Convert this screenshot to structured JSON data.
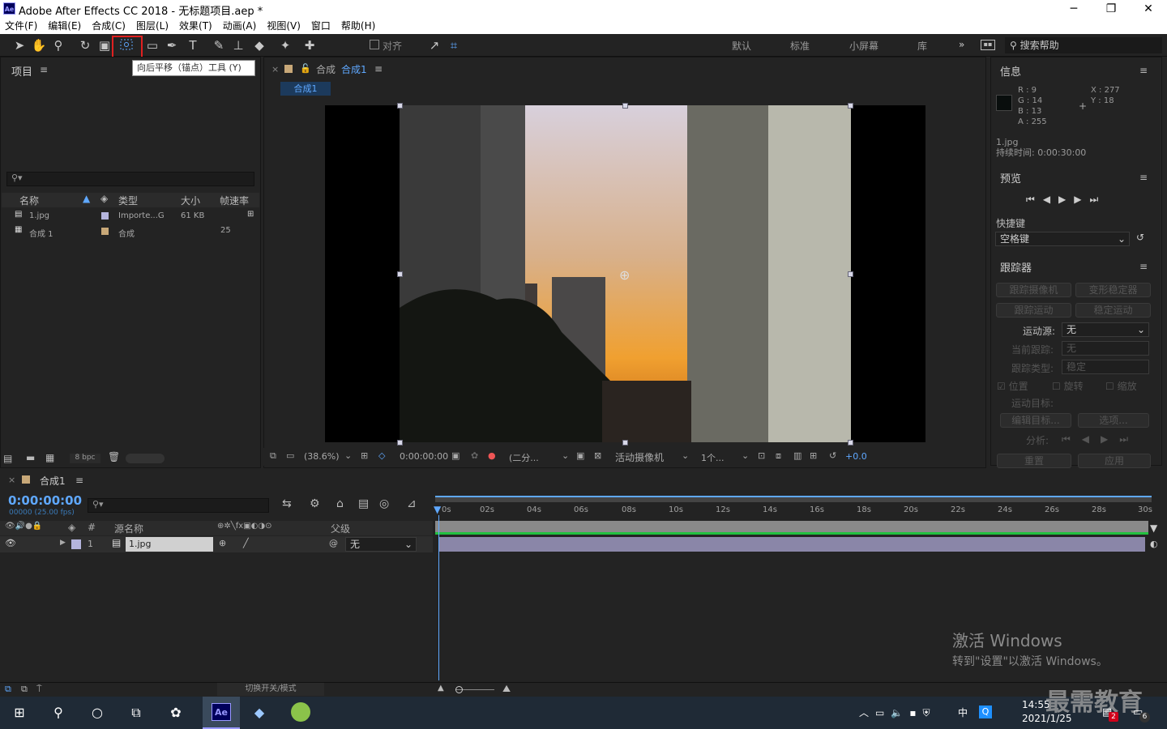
{
  "app": {
    "title": "Adobe After Effects CC 2018 - 无标题项目.aep *",
    "icon": "Ae"
  },
  "menu": [
    "文件(F)",
    "编辑(E)",
    "合成(C)",
    "图层(L)",
    "效果(T)",
    "动画(A)",
    "视图(V)",
    "窗口",
    "帮助(H)"
  ],
  "toolbar": {
    "align_label": "对齐",
    "tooltip": "向后平移（锚点）工具 (Y)",
    "workspaces": [
      "默认",
      "标准",
      "小屏幕",
      "库"
    ],
    "overflow": "»",
    "search_help": "搜索帮助"
  },
  "project": {
    "title": "项目",
    "columns": [
      "名称",
      "类型",
      "大小",
      "帧速率"
    ],
    "items": [
      {
        "name": "1.jpg",
        "type": "Importe...G",
        "size": "61 KB",
        "fps": "",
        "color": "#b4b4dc"
      },
      {
        "name": "合成 1",
        "type": "合成",
        "size": "",
        "fps": "25",
        "color": "#c8a878"
      }
    ],
    "bpc": "8 bpc"
  },
  "composition": {
    "tab_prefix": "合成",
    "tab_name": "合成1",
    "breadcrumb": "合成1",
    "zoom": "(38.6%)",
    "timecode": "0:00:00:00",
    "resolution": "(二分...",
    "camera": "活动摄像机",
    "views": "1个...",
    "exposure": "+0.0"
  },
  "info": {
    "title": "信息",
    "r": "R : 9",
    "g": "G : 14",
    "b": "B : 13",
    "a": "A : 255",
    "x": "X : 277",
    "y": "Y : 18",
    "file": "1.jpg",
    "duration": "持续时间: 0:00:30:00"
  },
  "preview": {
    "title": "预览",
    "shortcut_label": "快捷键",
    "shortcut_value": "空格键"
  },
  "tracker": {
    "title": "跟踪器",
    "btn_track_camera": "跟踪摄像机",
    "btn_warp_stabilizer": "变形稳定器",
    "btn_track_motion": "跟踪运动",
    "btn_stabilize_motion": "稳定运动",
    "motion_source_label": "运动源:",
    "motion_source_value": "无",
    "current_track_label": "当前跟踪:",
    "current_track_value": "无",
    "track_type_label": "跟踪类型:",
    "track_type_value": "稳定",
    "position": "位置",
    "rotation": "旋转",
    "scale": "缩放",
    "motion_target": "运动目标:",
    "edit_target": "编辑目标...",
    "options": "选项...",
    "analyze": "分析:",
    "reset": "重置",
    "apply": "应用"
  },
  "timeline": {
    "tab_name": "合成1",
    "timecode": "0:00:00:00",
    "frame_info": "00000 (25.00 fps)",
    "col_source": "源名称",
    "col_parent": "父级",
    "col_hash": "#",
    "layer_num": "1",
    "layer_name": "1.jpg",
    "parent_value": "无",
    "toggle_label": "切换开关/模式",
    "ticks": [
      "0s",
      "02s",
      "04s",
      "06s",
      "08s",
      "10s",
      "12s",
      "14s",
      "16s",
      "18s",
      "20s",
      "22s",
      "24s",
      "26s",
      "28s",
      "30s"
    ]
  },
  "watermark": {
    "line1": "激活 Windows",
    "line2": "转到\"设置\"以激活 Windows。"
  },
  "taskbar": {
    "time": "14:55",
    "date": "2021/1/25",
    "ime": "中",
    "logo_text": "最需教育",
    "badge_mail": "2",
    "badge_notify": "6"
  }
}
